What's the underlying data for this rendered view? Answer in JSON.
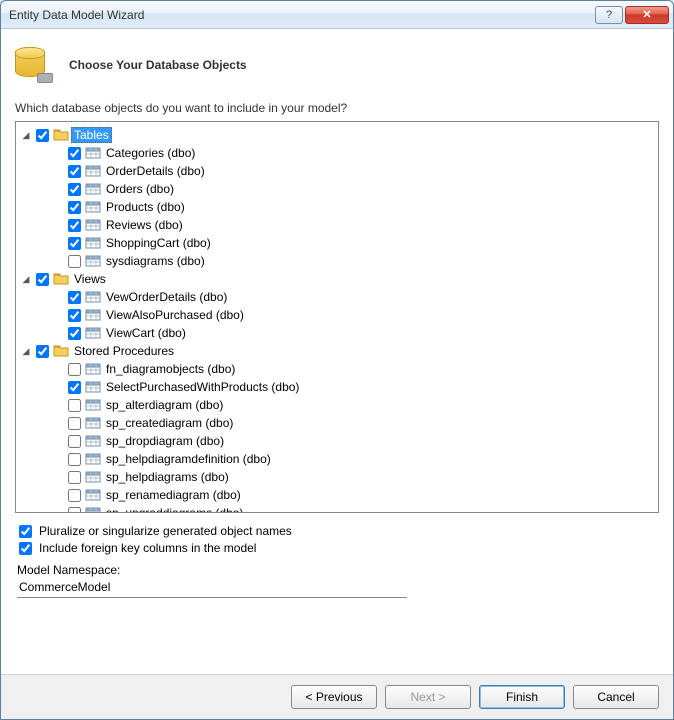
{
  "window": {
    "title": "Entity Data Model Wizard"
  },
  "header": {
    "title": "Choose Your Database Objects"
  },
  "prompt": "Which database objects do you want to include in your model?",
  "tree": {
    "tables": {
      "label": "Tables",
      "items": [
        {
          "label": "Categories (dbo)",
          "checked": true
        },
        {
          "label": "OrderDetails (dbo)",
          "checked": true
        },
        {
          "label": "Orders (dbo)",
          "checked": true
        },
        {
          "label": "Products (dbo)",
          "checked": true
        },
        {
          "label": "Reviews (dbo)",
          "checked": true
        },
        {
          "label": "ShoppingCart (dbo)",
          "checked": true
        },
        {
          "label": "sysdiagrams (dbo)",
          "checked": false
        }
      ]
    },
    "views": {
      "label": "Views",
      "items": [
        {
          "label": "VewOrderDetails (dbo)",
          "checked": true
        },
        {
          "label": "ViewAlsoPurchased (dbo)",
          "checked": true
        },
        {
          "label": "ViewCart (dbo)",
          "checked": true
        }
      ]
    },
    "sprocs": {
      "label": "Stored Procedures",
      "items": [
        {
          "label": "fn_diagramobjects (dbo)",
          "checked": false
        },
        {
          "label": "SelectPurchasedWithProducts (dbo)",
          "checked": true
        },
        {
          "label": "sp_alterdiagram (dbo)",
          "checked": false
        },
        {
          "label": "sp_creatediagram (dbo)",
          "checked": false
        },
        {
          "label": "sp_dropdiagram (dbo)",
          "checked": false
        },
        {
          "label": "sp_helpdiagramdefinition (dbo)",
          "checked": false
        },
        {
          "label": "sp_helpdiagrams (dbo)",
          "checked": false
        },
        {
          "label": "sp_renamediagram (dbo)",
          "checked": false
        },
        {
          "label": "sp_upgraddiagrams (dbo)",
          "checked": false
        }
      ]
    }
  },
  "options": {
    "pluralize": {
      "label": "Pluralize or singularize generated object names",
      "checked": true
    },
    "fk": {
      "label": "Include foreign key columns in the model",
      "checked": true
    }
  },
  "namespace": {
    "label": "Model Namespace:",
    "value": "CommerceModel"
  },
  "buttons": {
    "previous": "< Previous",
    "next": "Next >",
    "finish": "Finish",
    "cancel": "Cancel"
  }
}
